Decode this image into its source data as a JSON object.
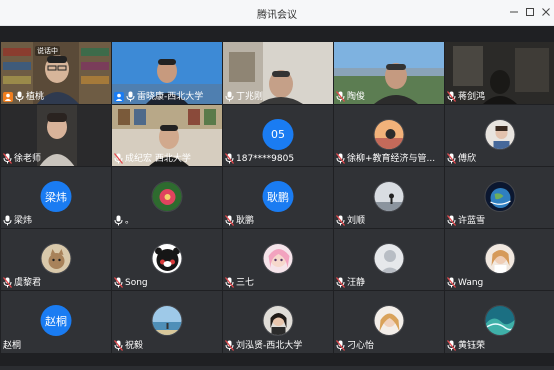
{
  "window": {
    "title": "腾讯会议"
  },
  "colors": {
    "accent": "#1a7cf2",
    "host_badge": "#f07e1f",
    "tile_bg": "#303236",
    "gallery_bg": "#1f2023"
  },
  "speaking_tag": "说话中",
  "participants": [
    {
      "name": "植桃",
      "type": "video",
      "icon": "host-person-icon",
      "mic": "mic-on",
      "scene": "bookshelf-man-glasses"
    },
    {
      "name": "雷晓康-西北大学",
      "type": "video",
      "icon": "person-icon",
      "mic": "mic-on",
      "scene": "blue-sky-man"
    },
    {
      "name": "丁兆刚",
      "type": "video",
      "icon": "",
      "mic": "mic-on",
      "scene": "office-man"
    },
    {
      "name": "陶俊",
      "type": "video",
      "icon": "",
      "mic": "mic-muted",
      "scene": "outdoor-man"
    },
    {
      "name": "蒋剑鸿",
      "type": "video",
      "icon": "",
      "mic": "mic-muted",
      "scene": "dark-room"
    },
    {
      "name": "徐老师",
      "type": "video",
      "icon": "",
      "mic": "mic-muted",
      "scene": "woman-dark"
    },
    {
      "name": "成纪宏  西北大学",
      "type": "video",
      "icon": "",
      "mic": "mic-muted",
      "scene": "bookshelf-young-man"
    },
    {
      "name": "187****9805",
      "type": "text-avatar",
      "avatar_text": "05",
      "mic": "mic-muted"
    },
    {
      "name": "徐柳+教育经济与管...",
      "type": "photo-avatar",
      "avatar": "sunset-woman-photo",
      "mic": "mic-muted"
    },
    {
      "name": "傅欣",
      "type": "photo-avatar",
      "avatar": "girl-photo",
      "mic": "mic-muted"
    },
    {
      "name": "梁炜",
      "type": "text-avatar",
      "avatar_text": "梁炜",
      "mic": "mic-on"
    },
    {
      "name": "。",
      "type": "photo-avatar",
      "avatar": "flower-photo",
      "mic": "mic-on"
    },
    {
      "name": "耿鹏",
      "type": "text-avatar",
      "avatar_text": "耿鹏",
      "mic": "mic-muted"
    },
    {
      "name": "刘顺",
      "type": "photo-avatar",
      "avatar": "silhouette-photo",
      "mic": "mic-muted"
    },
    {
      "name": "许蓝雪",
      "type": "photo-avatar",
      "avatar": "earth-photo",
      "mic": "mic-muted"
    },
    {
      "name": "虞黎君",
      "type": "photo-avatar",
      "avatar": "cat-photo",
      "mic": "mic-muted"
    },
    {
      "name": "Song",
      "type": "photo-avatar",
      "avatar": "kumamon-photo",
      "mic": "mic-muted"
    },
    {
      "name": "三七",
      "type": "photo-avatar",
      "avatar": "anime-girl-photo",
      "mic": "mic-muted"
    },
    {
      "name": "汪静",
      "type": "photo-avatar",
      "avatar": "default-person-icon",
      "mic": "mic-muted"
    },
    {
      "name": "Wang",
      "type": "photo-avatar",
      "avatar": "bride-photo",
      "mic": "mic-muted"
    },
    {
      "name": "赵桐",
      "type": "text-avatar",
      "avatar_text": "赵桐",
      "mic": "none"
    },
    {
      "name": "祝毅",
      "type": "photo-avatar",
      "avatar": "sea-photo",
      "mic": "mic-muted"
    },
    {
      "name": "刘泓贤-西北大学",
      "type": "photo-avatar",
      "avatar": "woman-portrait-photo",
      "mic": "mic-muted"
    },
    {
      "name": "刁心怡",
      "type": "photo-avatar",
      "avatar": "blonde-girl-photo",
      "mic": "mic-muted"
    },
    {
      "name": "黄钰荣",
      "type": "photo-avatar",
      "avatar": "wave-photo",
      "mic": "mic-muted"
    }
  ]
}
